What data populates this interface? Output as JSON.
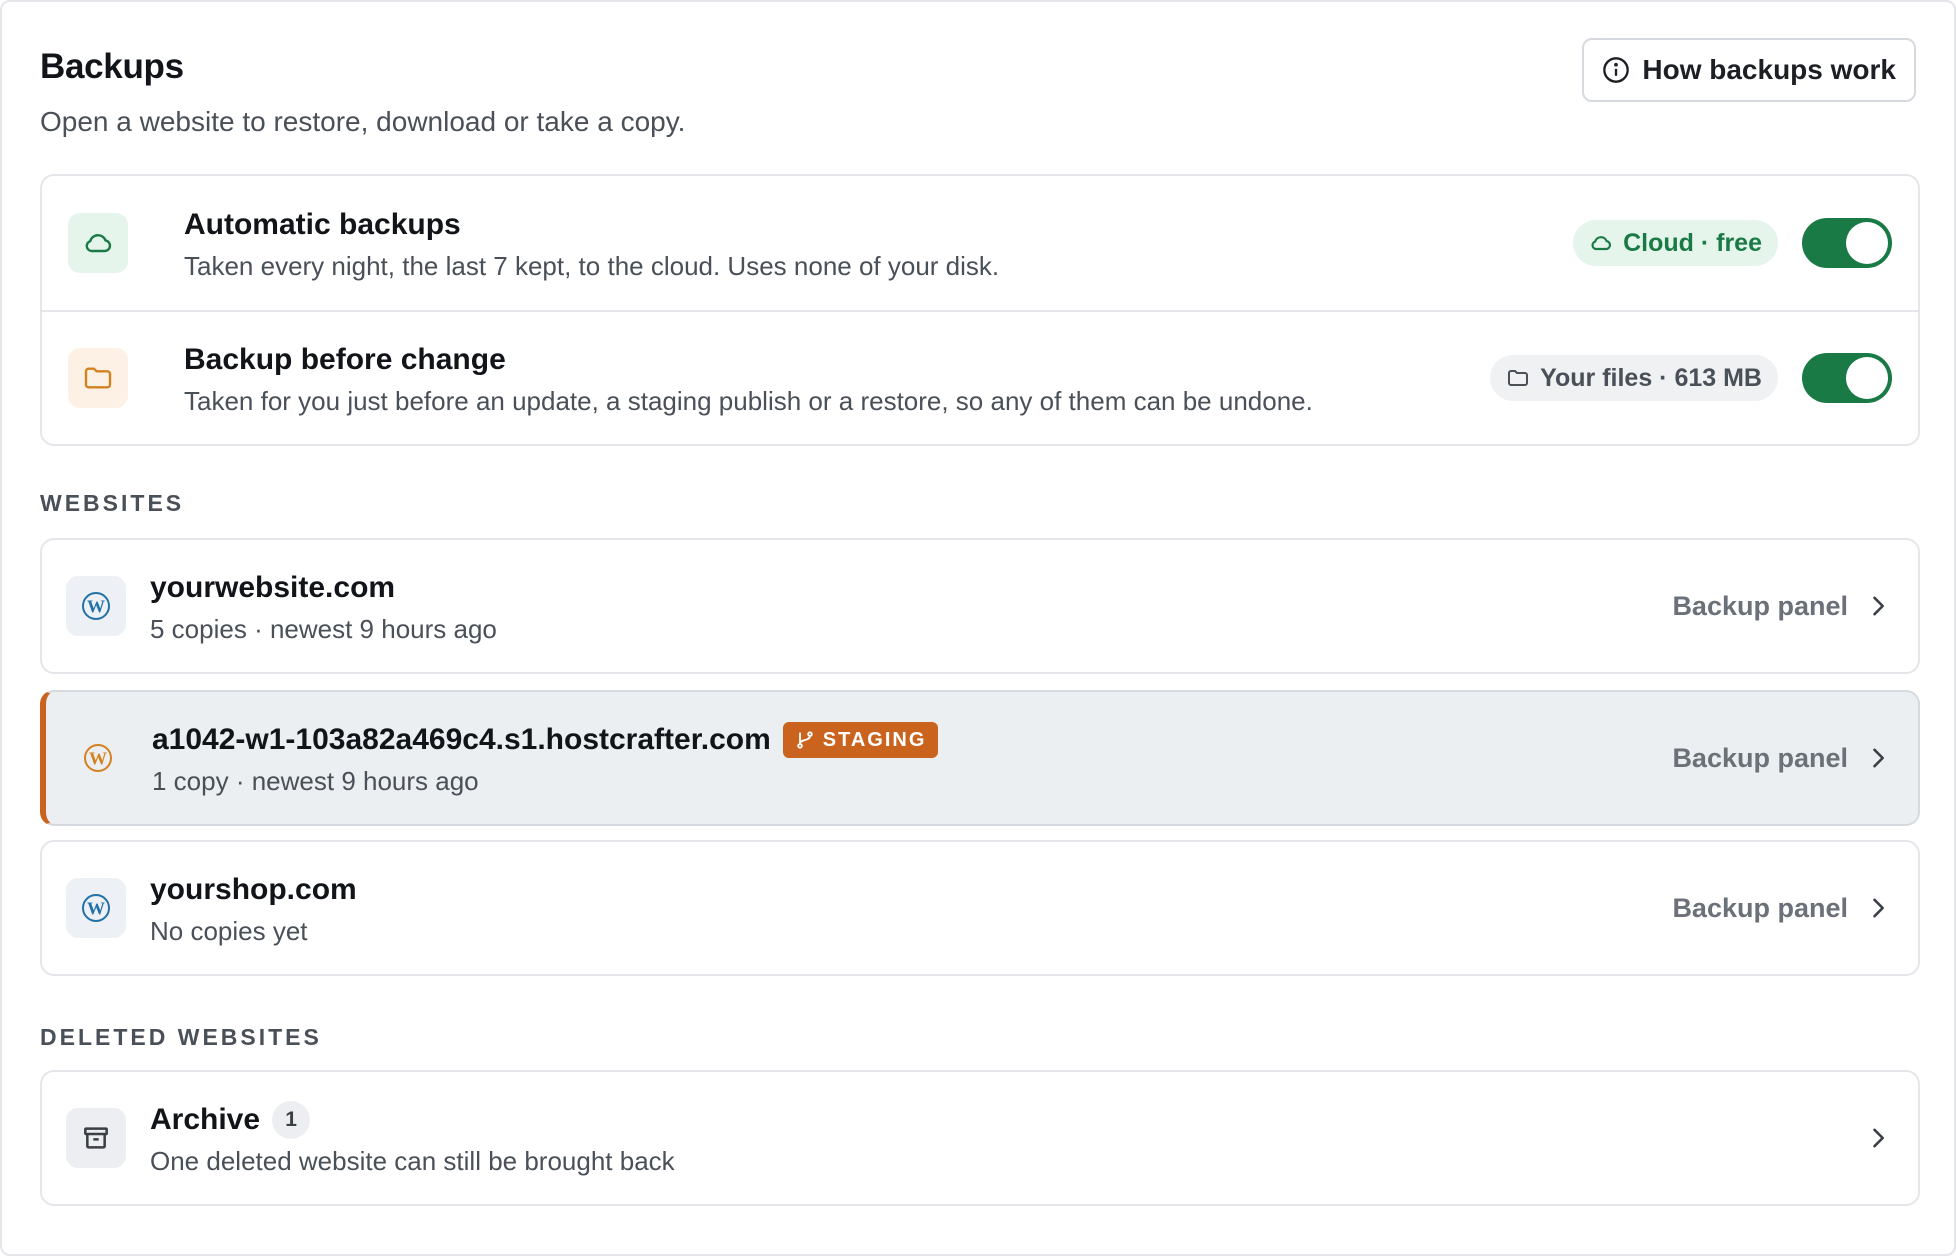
{
  "header": {
    "title": "Backups",
    "subtitle": "Open a website to restore, download or take a copy.",
    "help_label": "How backups work"
  },
  "settings": [
    {
      "title": "Automatic backups",
      "description": "Taken every night, the last 7 kept, to the cloud. Uses none of your disk.",
      "pill": "Cloud · free",
      "enabled": true
    },
    {
      "title": "Backup before change",
      "description": "Taken for you just before an update, a staging publish or a restore, so any of them can be undone.",
      "pill": "Your files · 613 MB",
      "enabled": true
    }
  ],
  "websites_label": "WEBSITES",
  "websites": [
    {
      "name": "yourwebsite.com",
      "meta": "5 copies · newest 9 hours ago",
      "link": "Backup panel"
    },
    {
      "name": "a1042-w1-103a82a469c4.s1.hostcrafter.com",
      "badge": "STAGING",
      "meta": "1 copy · newest 9 hours ago",
      "link": "Backup panel"
    },
    {
      "name": "yourshop.com",
      "meta": "No copies yet",
      "link": "Backup panel"
    }
  ],
  "deleted_label": "DELETED WEBSITES",
  "archive": {
    "title": "Archive",
    "count": "1",
    "description": "One deleted website can still be brought back"
  },
  "colors": {
    "accent_green": "#1a7a45",
    "staging_orange": "#c9631d",
    "wordpress_blue": "#2271a8"
  }
}
